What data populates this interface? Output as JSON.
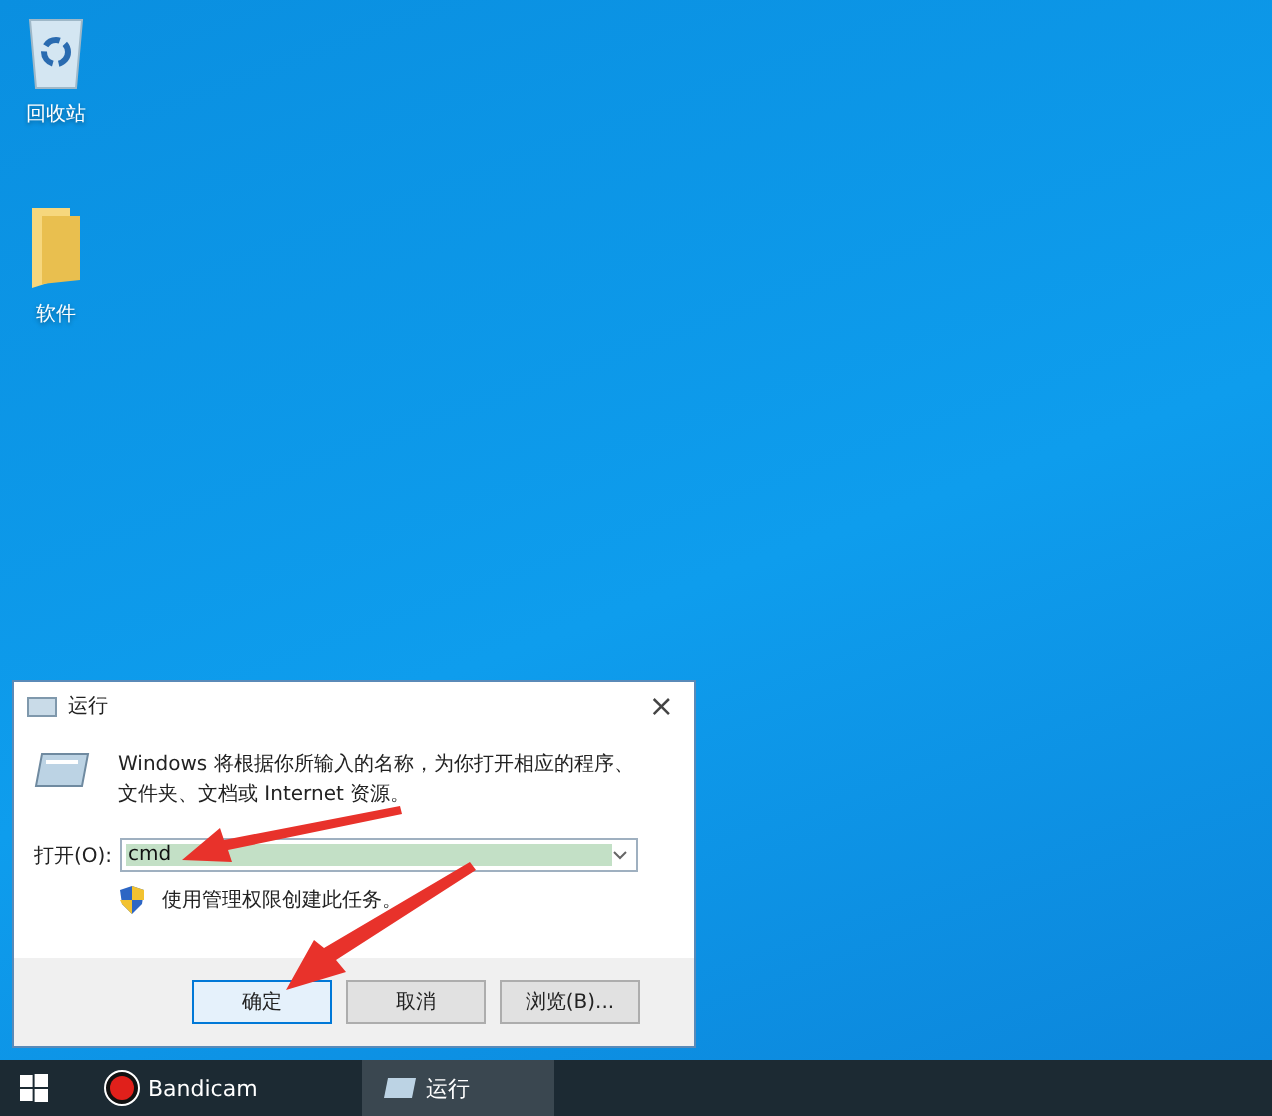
{
  "desktop_icons": [
    {
      "label": "回收站",
      "kind": "recycle"
    },
    {
      "label": "软件",
      "kind": "folder"
    }
  ],
  "dialog": {
    "title": "运行",
    "close": "×",
    "description": "Windows 将根据你所输入的名称，为你打开相应的程序、文件夹、文档或 Internet 资源。",
    "open_label": "打开(O):",
    "input": {
      "value": "cmd",
      "selected": true
    },
    "admin_note": "使用管理权限创建此任务。",
    "buttons": [
      {
        "label": "确定",
        "default": true
      },
      {
        "label": "取消",
        "default": false
      },
      {
        "label": "浏览(B)...",
        "default": false
      }
    ]
  },
  "taskbar": {
    "items": [
      {
        "label": "Bandicam",
        "kind": "record",
        "active": false
      },
      {
        "label": "运行",
        "kind": "run",
        "active": true
      }
    ]
  }
}
